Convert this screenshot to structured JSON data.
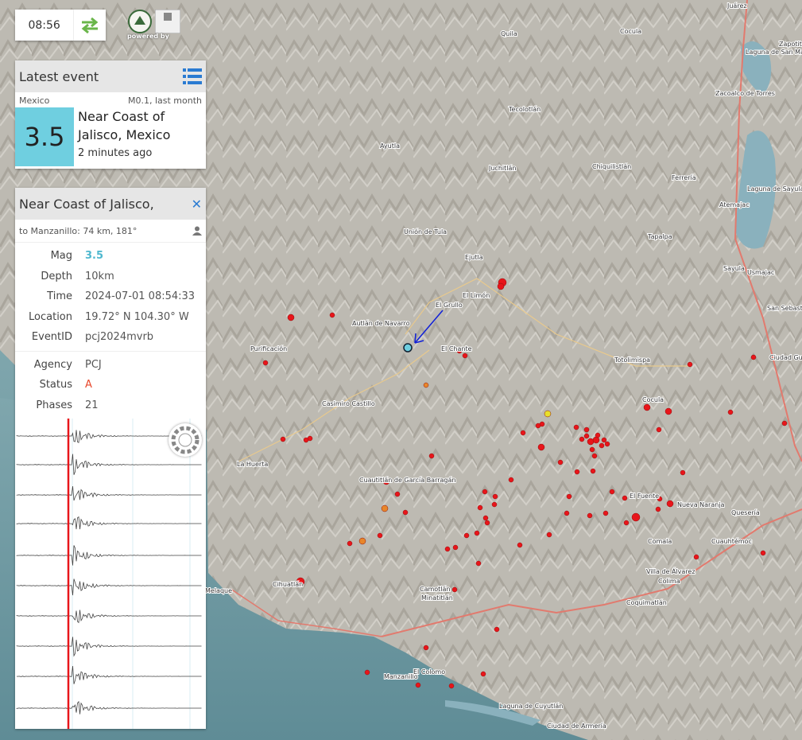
{
  "clock": {
    "time": "08:56",
    "swap_icon": "swap-arrows-icon"
  },
  "logos": {
    "credit": "powered by"
  },
  "latest": {
    "title": "Latest event",
    "region": "Mexico",
    "summary": "M0.1, last month",
    "magnitude": "3.5",
    "place_line1": "Near Coast of",
    "place_line2": "Jalisco, Mexico",
    "ago": "2 minutes ago",
    "list_icon": "list-icon"
  },
  "detail": {
    "title": "Near Coast of Jalisco,",
    "distance": "to Manzanillo: 74 km, 181°",
    "mag_label": "Mag",
    "mag": "3.5",
    "depth_label": "Depth",
    "depth": "10km",
    "time_label": "Time",
    "time": "2024-07-01 08:54:33",
    "location_label": "Location",
    "location": "19.72° N 104.30° W",
    "eventid_label": "EventID",
    "eventid": "pcj2024mvrb",
    "agency_label": "Agency",
    "agency": "PCJ",
    "status_label": "Status",
    "status": "A",
    "phases_label": "Phases",
    "phases": "21"
  },
  "colors": {
    "accent": "#6fcfe0",
    "quake": "#e8151a",
    "status": "#e8462a",
    "land": "#b9b6ae",
    "sea": "#6e97a0"
  },
  "map_labels": [
    {
      "text": "Juárez"
    },
    {
      "text": "Cocula"
    },
    {
      "text": "Quila"
    },
    {
      "text": "Tecolotlán"
    },
    {
      "text": "Ayutla"
    },
    {
      "text": "Juchitlán"
    },
    {
      "text": "Chiquilistlán"
    },
    {
      "text": "Ferrería"
    },
    {
      "text": "Atemajac"
    },
    {
      "text": "Tapalpa"
    },
    {
      "text": "Unión de Tula"
    },
    {
      "text": "Ejutla"
    },
    {
      "text": "El Limón"
    },
    {
      "text": "El Grullo"
    },
    {
      "text": "Autlán de Navarro"
    },
    {
      "text": "El Chante"
    },
    {
      "text": "Purificación"
    },
    {
      "text": "Casimiro Castillo"
    },
    {
      "text": "Totolimispa"
    },
    {
      "text": "Sayula"
    },
    {
      "text": "Usmajac"
    },
    {
      "text": "Cocula"
    },
    {
      "text": "La Huerta"
    },
    {
      "text": "Cuautitlán de García Barragán"
    },
    {
      "text": "El Fuente"
    },
    {
      "text": "Nueva Naranja"
    },
    {
      "text": "Quesería"
    },
    {
      "text": "Comala"
    },
    {
      "text": "Cuauhtémoc"
    },
    {
      "text": "Villa de Álvarez"
    },
    {
      "text": "Colima"
    },
    {
      "text": "Cihuatlán"
    },
    {
      "text": "Melaque"
    },
    {
      "text": "Camotlán"
    },
    {
      "text": "Minatitlán"
    },
    {
      "text": "Coquimatlán"
    },
    {
      "text": "Manzanillo"
    },
    {
      "text": "El Colomo"
    },
    {
      "text": "Laguna de Cuyutlán"
    },
    {
      "text": "Ciudad de Armería"
    },
    {
      "text": "Ciudad Guzmán"
    },
    {
      "text": "Zapotitán de Hidalgo"
    },
    {
      "text": "Zacoalco de Torres"
    },
    {
      "text": "Laguna de San Marcos"
    },
    {
      "text": "Laguna de Sayula"
    },
    {
      "text": "San Sebastián del Sur"
    }
  ]
}
